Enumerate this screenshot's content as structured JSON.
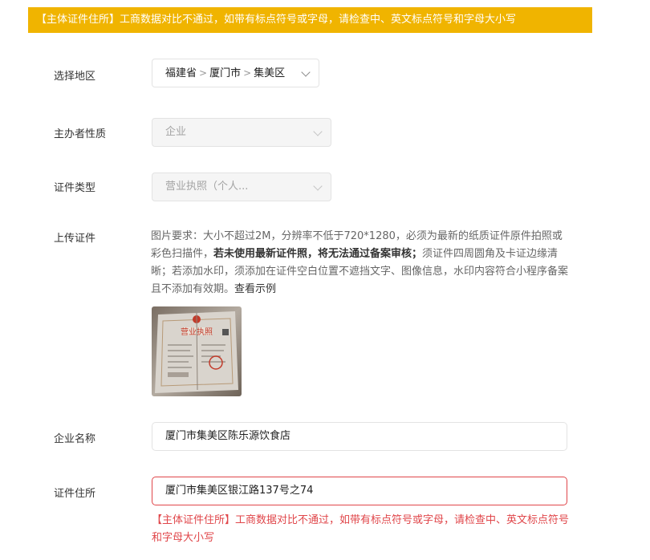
{
  "banner": {
    "text": "【主体证件住所】工商数据对比不通过，如带有标点符号或字母，请检查中、英文标点符号和字母大小写"
  },
  "form": {
    "region": {
      "label": "选择地区",
      "province": "福建省",
      "city": "厦门市",
      "district": "集美区",
      "separator": ">"
    },
    "organizer_type": {
      "label": "主办者性质",
      "value": "企业",
      "disabled": true
    },
    "cert_type": {
      "label": "证件类型",
      "value": "营业执照（个人...",
      "disabled": true
    },
    "upload": {
      "label": "上传证件",
      "req_part1": "图片要求：大小不超过2M，分辨率不低于720*1280，必须为最新的纸质证件原件拍照或彩色扫描件，",
      "req_bold": "若未使用最新证件照，将无法通过备案审核；",
      "req_part2": "须证件四周圆角及卡证边缘清晰；若添加水印，须添加在证件空白位置不遮挡文字、图像信息，水印内容符合小程序备案且不添加有效期。",
      "example_link": "查看示例",
      "thumbnail_caption": "营业执照"
    },
    "company_name": {
      "label": "企业名称",
      "value": "厦门市集美区陈乐源饮食店"
    },
    "cert_address": {
      "label": "证件住所",
      "value": "厦门市集美区银江路137号之74",
      "error": "【主体证件住所】工商数据对比不通过，如带有标点符号或字母，请检查中、英文标点符号和字母大小写"
    }
  },
  "colors": {
    "banner_bg": "#f0b400",
    "error": "#e0464a",
    "disabled_bg": "#f5f5f5"
  }
}
